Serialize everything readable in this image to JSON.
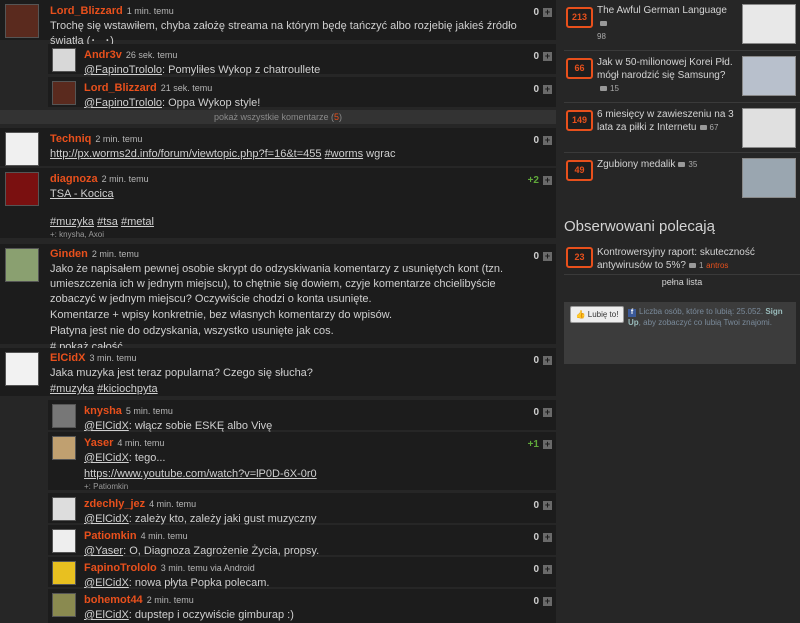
{
  "entries": [
    {
      "user": "Lord_Blizzard",
      "time": "1 min. temu",
      "score": "0",
      "text": "Trochę się wstawiłem, chyba założę streama na którym będę tańczyć albo rozjebię jakieś źródło światła (･‿･)"
    },
    {
      "user": "Andr3v",
      "time": "26 sek. temu",
      "score": "0",
      "mention": "@FapinoTrololo",
      "text": ": Pomyliłes Wykop z chatroullete"
    },
    {
      "user": "Lord_Blizzard",
      "time": "21 sek. temu",
      "score": "0",
      "mention": "@FapinoTrololo",
      "text": ": Oppa Wykop style!"
    },
    {
      "user": "Techniq",
      "time": "2 min. temu",
      "score": "0",
      "link": "http://px.worms2d.info/forum/viewtopic.php?f=16&t=455",
      "tag": "#worms",
      "text": " wgrac"
    },
    {
      "user": "diagnoza",
      "time": "2 min. temu",
      "score": "+2",
      "line1": "TSA - Kocica",
      "tag1": "#muzyka",
      "tag2": "#tsa",
      "tag3": "#metal",
      "plus_text": "+: knysha, Axoi"
    },
    {
      "user": "Ginden",
      "time": "2 min. temu",
      "score": "0",
      "p1": "Jako że napisałem pewnej osobie skrypt do odzyskiwania komentarzy z usuniętych kont (tzn. umieszczenia ich w jednym miejscu), to chętnie się dowiem, czyje komentarze chcielibyście zobaczyć w jednym miejscu? Oczywiście chodzi o konta usunięte.",
      "p2": "Komentarze + wpisy konkretnie, bez własnych komentarzy do wpisów.",
      "p3": "Płatyna jest nie do odzyskania, wszystko usunięte jak cos.",
      "more_prefix": "# ",
      "more": "pokaż całość"
    },
    {
      "user": "ElCidX",
      "time": "3 min. temu",
      "score": "0",
      "line1": "Jaka muzyka jest teraz popularna? Czego się słucha?",
      "tag1": "#muzyka",
      "tag2": "#kiciochpyta"
    },
    {
      "user": "knysha",
      "time": "5 min. temu",
      "score": "0",
      "mention": "@ElCidX",
      "text": ": włącz sobie ESKĘ albo Vivę"
    },
    {
      "user": "Yaser",
      "time": "4 min. temu",
      "score": "+1",
      "mention": "@ElCidX",
      "text": ": tego...",
      "link": "https://www.youtube.com/watch?v=lP0D-6X-0r0",
      "plus_text": "+: Patiomkin"
    },
    {
      "user": "zdechly_jez",
      "time": "4 min. temu",
      "score": "0",
      "mention": "@ElCidX",
      "text": ": zależy kto, zależy jaki gust muzyczny"
    },
    {
      "user": "Patiomkin",
      "time": "4 min. temu",
      "score": "0",
      "mention": "@Yaser",
      "text": ": O, Diagnoza Zagrożenie Życia, propsy."
    },
    {
      "user": "FapinoTrololo",
      "time": "3 min. temu via Android",
      "score": "0",
      "mention": "@ElCidX",
      "text": ": nowa płyta Popka polecam."
    },
    {
      "user": "bohemot44",
      "time": "2 min. temu",
      "score": "0",
      "mention": "@ElCidX",
      "text": ": dupstep i oczywiście gimburap :)"
    }
  ],
  "show_comments": {
    "label": "pokaż wszystkie komentarze (",
    "count": "5",
    "close": ")"
  },
  "sidebar": {
    "items": [
      {
        "count": "213",
        "title": "The Awful German Language",
        "comments": "98"
      },
      {
        "count": "66",
        "title": "Jak w 50-milionowej Korei Płd. mógł narodzić się Samsung?",
        "comments": "15"
      },
      {
        "count": "149",
        "title": "6 miesięcy w zawieszeniu na 3 lata za piłki z Internetu",
        "comments": "67"
      },
      {
        "count": "49",
        "title": "Zgubiony medalik",
        "comments": "35"
      }
    ],
    "observed_heading": "Obserwowani polecają",
    "observed": {
      "count": "23",
      "title": "Kontrowersyjny raport: skuteczność antywirusów to 5%?",
      "comments": "1",
      "author": "antros"
    },
    "full_list": "pełna lista",
    "facebook": {
      "like": "Lubię to!",
      "text": "Liczba osób, które to lubią: 25.052.",
      "signup": "Sign Up",
      "rest": ", aby zobaczyć co lubią Twoi znajomi."
    }
  },
  "colors": {
    "accent": "#e8501c",
    "positive": "#5fa83a",
    "background": "#262626",
    "entry_bg": "#1c1c1c"
  },
  "icons": {
    "plus": "plus-icon",
    "comments": "comment-icon",
    "facebook": "facebook-icon",
    "like": "thumb-up-icon"
  }
}
